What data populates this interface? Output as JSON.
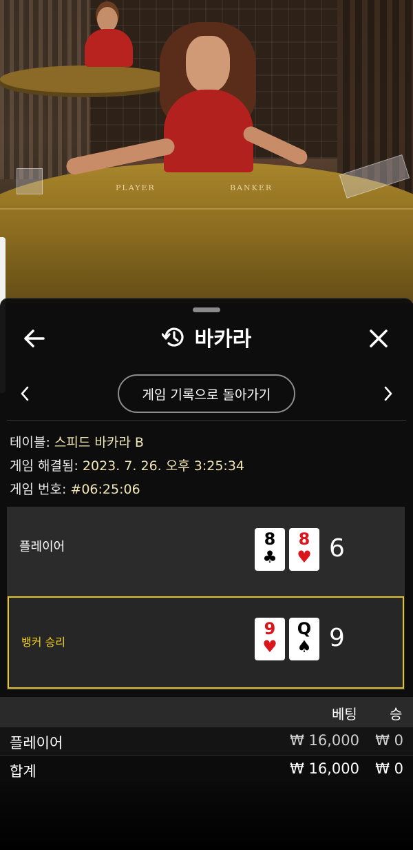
{
  "video": {
    "table_labels": [
      "PLAYER",
      "BANKER"
    ]
  },
  "header": {
    "title": "바카라",
    "back_icon": "arrow-left-icon",
    "history_icon": "history-icon",
    "close_icon": "close-icon"
  },
  "nav": {
    "back_to_history_label": "게임 기록으로 돌아가기",
    "prev_icon": "chevron-left-icon",
    "next_icon": "chevron-right-icon"
  },
  "info": {
    "table_label": "테이블: ",
    "table_value": "스피드 바카라 B",
    "resolved_label": "게임 해결됨: ",
    "resolved_value": "2023. 7. 26. 오후 3:25:34",
    "number_label": "게임 번호: ",
    "number_value": "#06:25:06"
  },
  "results": {
    "player": {
      "label": "플레이어",
      "cards": [
        {
          "rank": "8",
          "suit": "♣",
          "color": "black"
        },
        {
          "rank": "8",
          "suit": "♥",
          "color": "red"
        }
      ],
      "score": "6"
    },
    "banker": {
      "label": "뱅커 승리",
      "cards": [
        {
          "rank": "9",
          "suit": "♥",
          "color": "red"
        },
        {
          "rank": "Q",
          "suit": "♠",
          "color": "black"
        }
      ],
      "score": "9",
      "highlight_color": "#e6c619"
    }
  },
  "bets": {
    "col_bet": "베팅",
    "col_win": "승",
    "rows": [
      {
        "name": "플레이어",
        "bet": "₩ 16,000",
        "win": "₩ 0"
      }
    ],
    "total": {
      "name": "합계",
      "bet": "₩ 16,000",
      "win": "₩ 0"
    }
  }
}
